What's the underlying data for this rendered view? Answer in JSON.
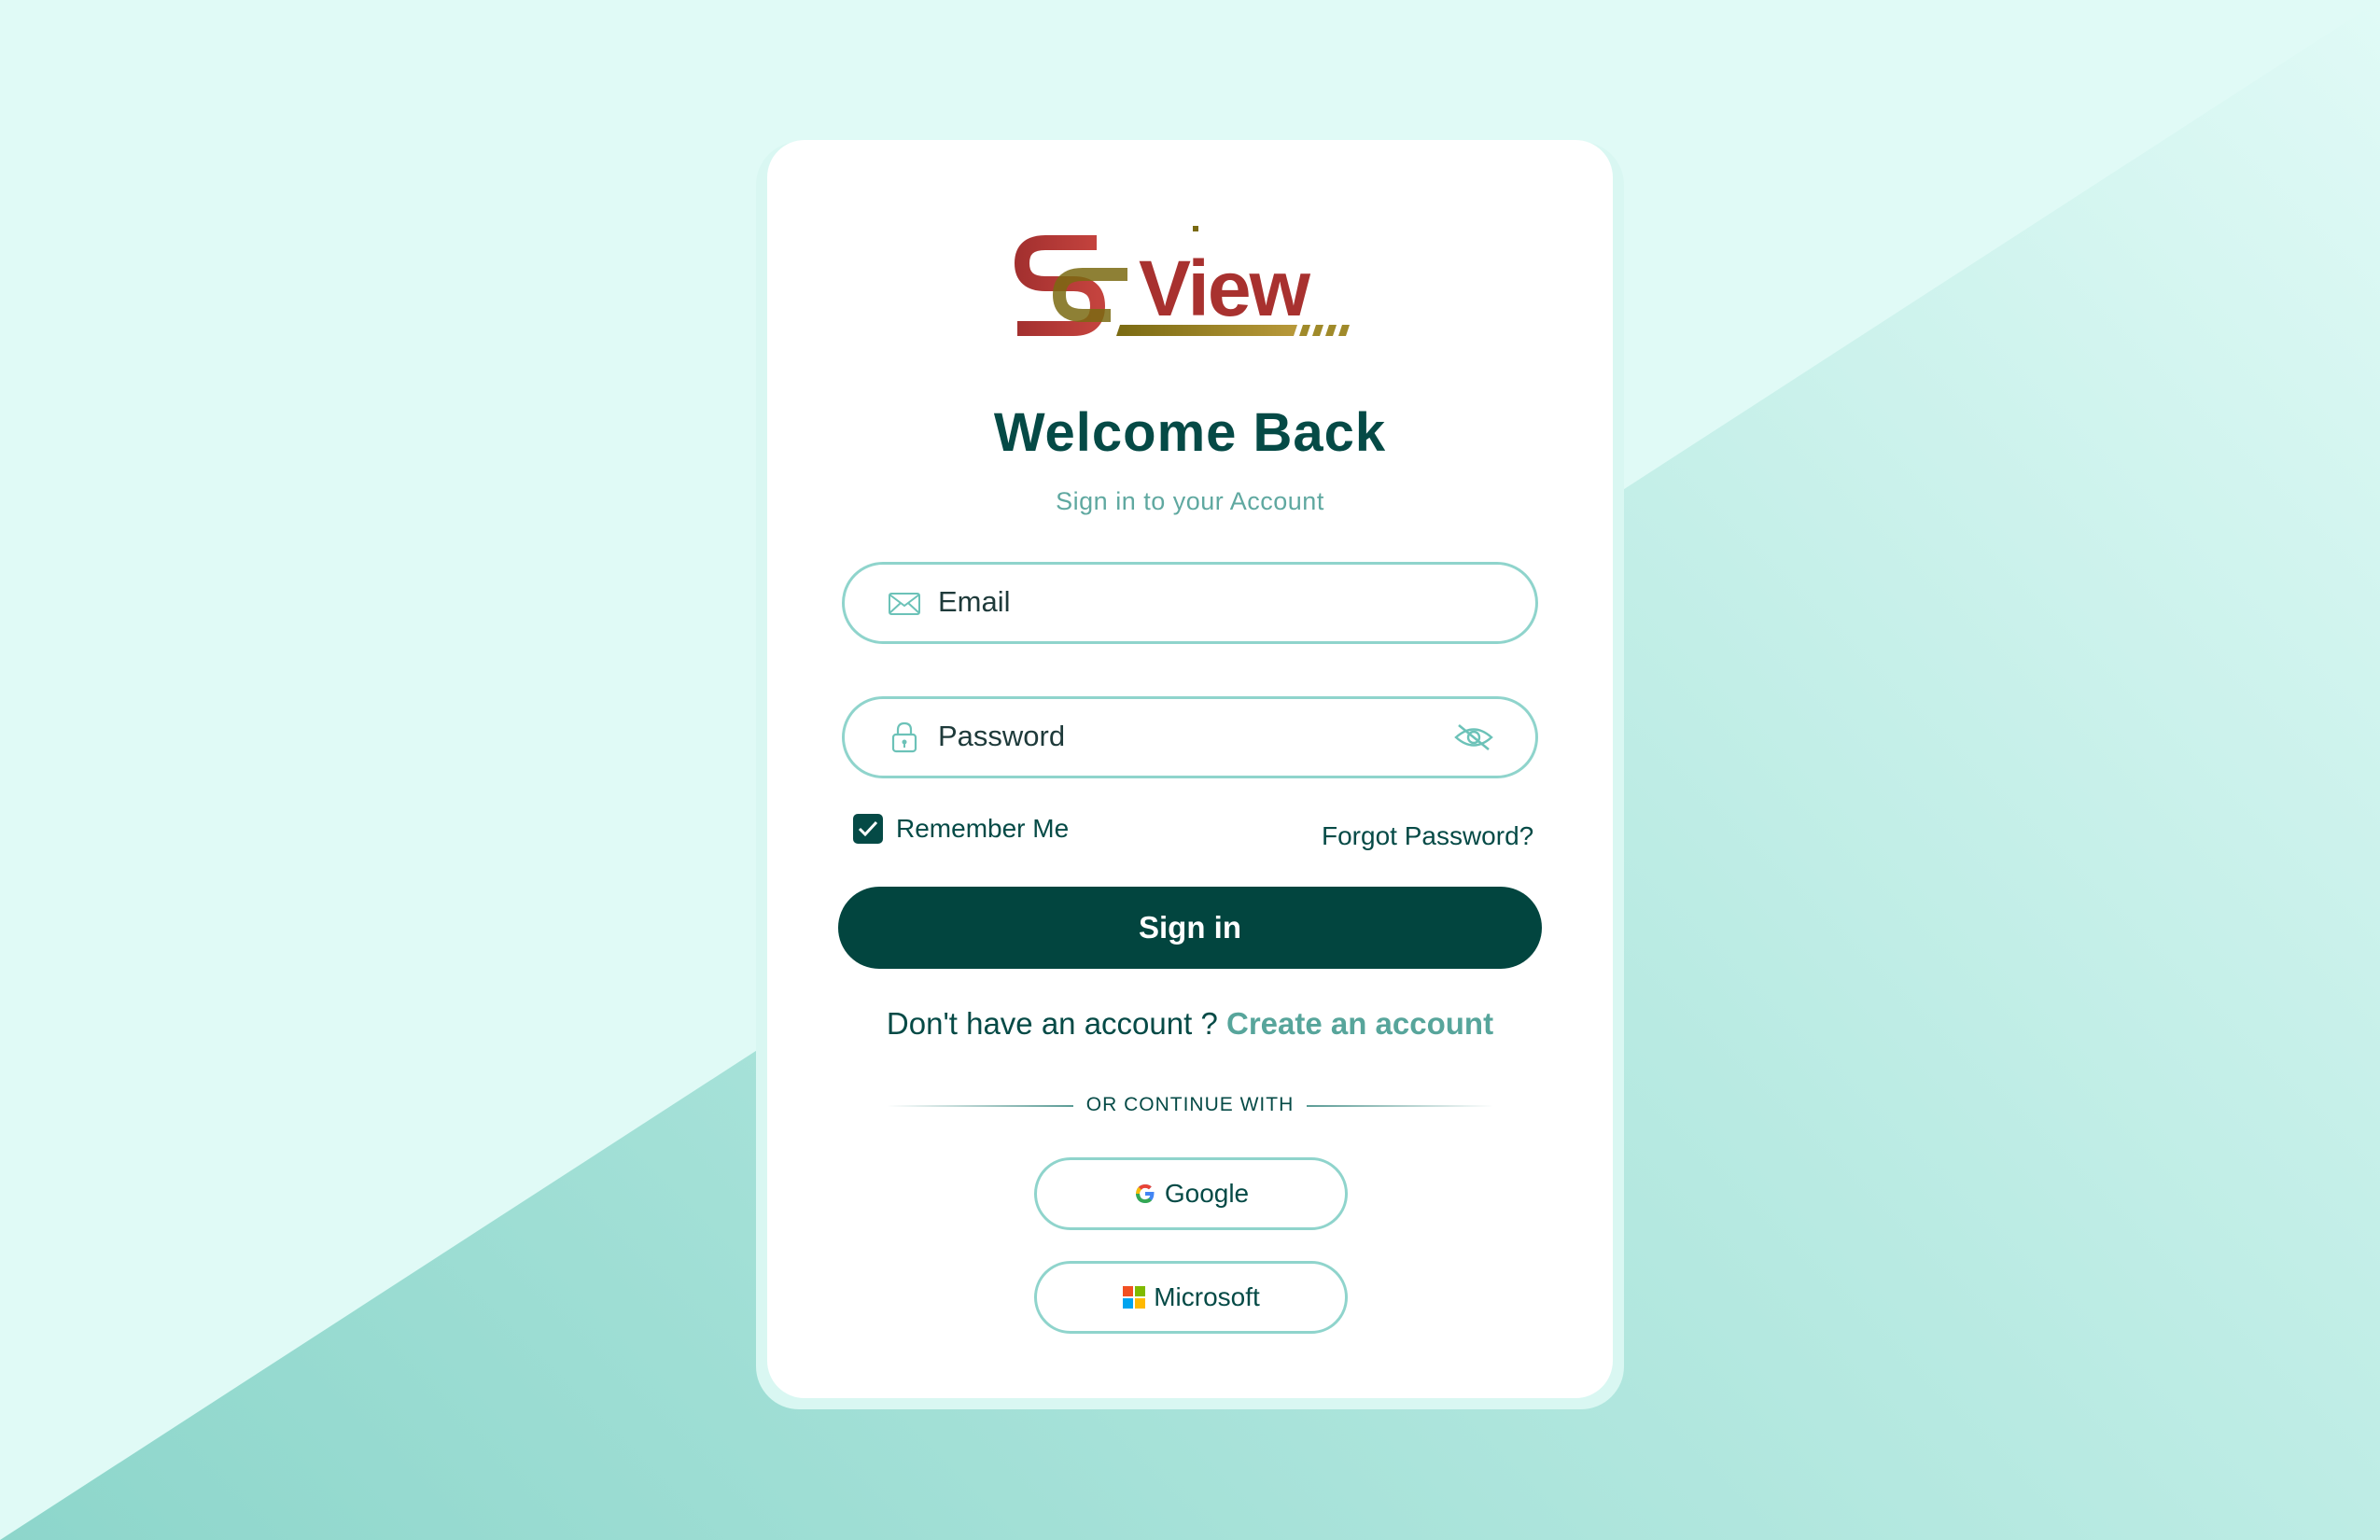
{
  "brand": {
    "logo_text": "SView",
    "logo_alt": "SView"
  },
  "login": {
    "title": "Welcome Back",
    "subtitle": "Sign in to your Account",
    "email_placeholder": "Email",
    "password_placeholder": "Password",
    "remember_label": "Remember Me",
    "remember_checked": true,
    "forgot_label": "Forgot Password?",
    "signin_label": "Sign in",
    "signup_prompt": "Don't have an account ?",
    "signup_link": "Create an account",
    "divider_text": "OR CONTINUE WITH",
    "google_label": "Google",
    "microsoft_label": "Microsoft"
  },
  "icons": {
    "email": "envelope-icon",
    "password": "lock-icon",
    "toggle_visibility": "eye-slash-icon",
    "remember": "checkmark-icon",
    "google": "google-icon",
    "microsoft": "microsoft-icon"
  },
  "colors": {
    "background": "#e0faf6",
    "accent_dark": "#02453f",
    "title": "#054a46",
    "link": "#57a59b",
    "field_border": "#8fd4cc",
    "logo_red": "#a3302f",
    "logo_olive": "#7a6a12"
  }
}
